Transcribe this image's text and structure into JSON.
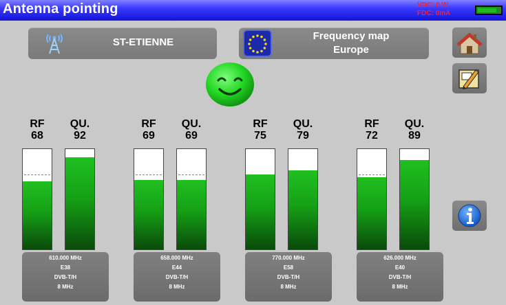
{
  "header": {
    "title": "Antenna pointing",
    "status_lines": [
      "VDC: 0 W",
      "FDC: 0mA"
    ],
    "battery_level": 0.85
  },
  "top_buttons": {
    "transmitter": {
      "label": "ST-ETIENNE",
      "icon": "transmitter-tower-icon"
    },
    "frequency_map": {
      "line1": "Frequency map",
      "line2": "Europe",
      "icon": "eu-flag-icon"
    }
  },
  "side_buttons": {
    "home": {
      "icon": "home-icon"
    },
    "edit": {
      "icon": "edit-pencil-icon"
    },
    "info": {
      "icon": "info-icon"
    }
  },
  "status_indicator": {
    "icon": "smiley-face-icon",
    "state": "good"
  },
  "channels": [
    {
      "rf_label": "RF",
      "rf_value": "68",
      "qu_label": "QU.",
      "qu_value": "92",
      "rf_level": 68,
      "qu_level": 92,
      "frequency": "610.000 MHz",
      "channel": "E38",
      "standard": "DVB-T/H",
      "bandwidth": "8 MHz"
    },
    {
      "rf_label": "RF",
      "rf_value": "69",
      "qu_label": "QU.",
      "qu_value": "69",
      "rf_level": 69,
      "qu_level": 69,
      "frequency": "658.000 MHz",
      "channel": "E44",
      "standard": "DVB-T/H",
      "bandwidth": "8 MHz"
    },
    {
      "rf_label": "RF",
      "rf_value": "75",
      "qu_label": "QU.",
      "qu_value": "79",
      "rf_level": 75,
      "qu_level": 79,
      "frequency": "770.000 MHz",
      "channel": "E58",
      "standard": "DVB-T/H",
      "bandwidth": "8 MHz"
    },
    {
      "rf_label": "RF",
      "rf_value": "72",
      "qu_label": "QU.",
      "qu_value": "89",
      "rf_level": 72,
      "qu_level": 89,
      "frequency": "626.000 MHz",
      "channel": "E40",
      "standard": "DVB-T/H",
      "bandwidth": "8 MHz"
    }
  ],
  "threshold_level": 74,
  "colors": {
    "titlebar": "#2020e0",
    "bar_fill": "#15a015",
    "status_text": "#ff2020",
    "background": "#c9c9c9"
  }
}
